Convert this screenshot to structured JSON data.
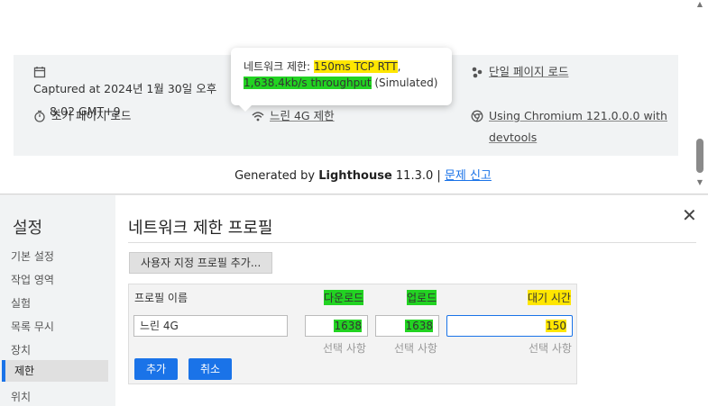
{
  "report": {
    "captured": "Captured at 2024년 1월 30일 오후",
    "captured_time": "8:02 GMT+9",
    "initial_load": "초기 페이지 로드",
    "throttling": "느린 4G 제한",
    "single_page": "단일 페이지 로드",
    "chromium": "Using Chromium 121.0.0.0 with",
    "chromium_2": "devtools",
    "tooltip": {
      "prefix": "네트워크 제한: ",
      "rtt": "150ms TCP RTT",
      "comma": ",",
      "throughput": "1,638.4kb/s throughput",
      "suffix": " (Simulated)"
    },
    "footer": {
      "generated": "Generated by ",
      "brand": "Lighthouse",
      "version": " 11.3.0 | ",
      "report_link": "문제 신고"
    }
  },
  "settings": {
    "title": "설정",
    "nav": [
      "기본 설정",
      "작업 영역",
      "실험",
      "목록 무시",
      "장치",
      "제한",
      "위치"
    ],
    "active_index": 5
  },
  "panel": {
    "title": "네트워크 제한 프로필",
    "add_profile": "사용자 지정 프로필 추가...",
    "col_name": "프로필 이름",
    "col_download": "다운로드",
    "col_upload": "업로드",
    "col_latency": "대기 시간",
    "name_value": "느린 4G",
    "download_value": "1638",
    "upload_value": "1638",
    "latency_value": "150",
    "optional": "선택 사항",
    "add_button": "추가",
    "cancel_button": "취소"
  },
  "colors": {
    "highlight_yellow": "#ffe600",
    "highlight_green": "#22d322",
    "accent_blue": "#1a73e8"
  }
}
